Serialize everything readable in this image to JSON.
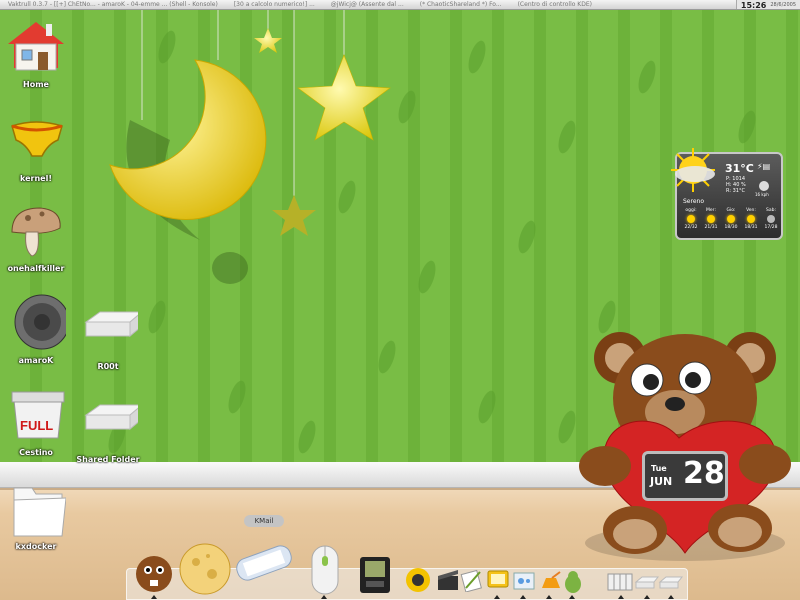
{
  "taskbar": {
    "tasks": [
      "Vaktrull 0.3.7 - [[+] ChEtNo... - amaroK - 04-emme ... (Shell - Konsole)",
      "[30 a calcolo numerico!] ...",
      "@jWicj@ (Assente dal ...",
      "(* ChaoticShareland *) Fo...",
      "(Centro di controllo KDE)"
    ],
    "time": "15:26",
    "date": "28/6/2005"
  },
  "desktop_icons": [
    {
      "label": "Home",
      "icon": "house-icon"
    },
    {
      "label": "kernel!",
      "icon": "underwear-icon"
    },
    {
      "label": "onehalfkiller",
      "icon": "mushroom-icon"
    },
    {
      "label": "amaroK",
      "icon": "speaker-icon"
    },
    {
      "label": "R00t",
      "icon": "drive-icon"
    },
    {
      "label": "Cestino",
      "icon": "trash-full-icon"
    },
    {
      "label": "Shared Folder",
      "icon": "drive-icon"
    },
    {
      "label": "kxdocker",
      "icon": "folder-icon"
    }
  ],
  "trash_badge": "FULL",
  "weather": {
    "temperature": "31°C",
    "details": [
      "P: 1014",
      "H: 40 %",
      "R: 31°C"
    ],
    "wind": "16 kph",
    "condition": "Sereno",
    "forecast": [
      {
        "day": "oggi:",
        "range": "22/32"
      },
      {
        "day": "Mer:",
        "range": "21/31"
      },
      {
        "day": "Gio:",
        "range": "18/30"
      },
      {
        "day": "Ven:",
        "range": "18/31"
      },
      {
        "day": "Sab:",
        "range": "17/28"
      }
    ]
  },
  "dock": {
    "tooltip": "KMail",
    "items": [
      "beaver-icon",
      "cheese-icon",
      "mail-icon",
      "mouse-icon",
      "pda-icon",
      "camera-icon",
      "clapper-icon",
      "editor-icon",
      "monitor-icon",
      "network-icon",
      "kettle-icon",
      "penguin-icon",
      "book-icon",
      "drive-icon",
      "drive-icon"
    ]
  },
  "calendar": {
    "weekday": "Tue",
    "month": "JUN",
    "day": "28"
  },
  "colors": {
    "wallpaper": "#79bd45",
    "moon": "#f3d60f",
    "star": "#f5e53a",
    "bear_fur": "#8a4c1c",
    "heart": "#d42424"
  }
}
